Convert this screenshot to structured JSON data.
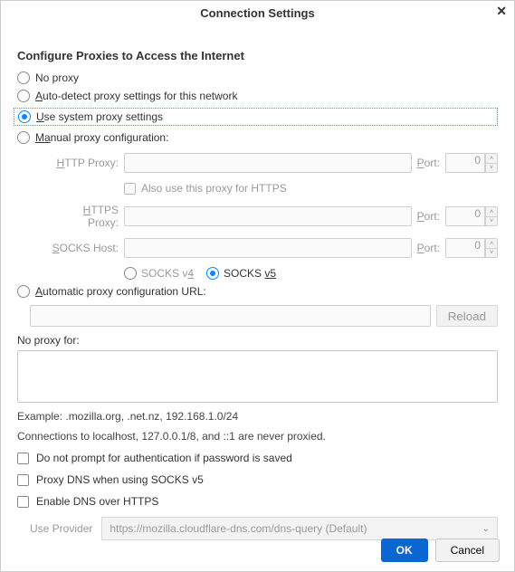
{
  "title": "Connection Settings",
  "heading": "Configure Proxies to Access the Internet",
  "radios": {
    "no_proxy": "No proxy",
    "auto_detect_pre": "A",
    "auto_detect_rest": "uto-detect proxy settings for this network",
    "use_system_pre": "U",
    "use_system_rest": "se system proxy settings",
    "manual_pre": "Ma",
    "manual_rest": "nual proxy configuration:",
    "pac_pre": "A",
    "pac_rest": "utomatic proxy configuration URL:"
  },
  "proxy": {
    "http_label_pre": "H",
    "http_label_rest": "TTP Proxy:",
    "https_label_pre": "H",
    "https_label_rest": "TTPS Proxy:",
    "socks_label_pre": "S",
    "socks_label_rest": "OCKS Host:",
    "port_label_pre": "P",
    "port_label_rest": "ort:",
    "port_value": "0",
    "also_https": "Also use this proxy for HTTPS",
    "socks4_pre": "SOCKS v",
    "socks4_rest": "4",
    "socks5_pre": "SOCKS ",
    "socks5_rest": "v5"
  },
  "reload": "Reload",
  "noproxy_label": "No proxy for:",
  "example": "Example: .mozilla.org, .net.nz, 192.168.1.0/24",
  "never_proxied": "Connections to localhost, 127.0.0.1/8, and ::1 are never proxied.",
  "checks": {
    "no_prompt": "Do not prompt for authentication if password is saved",
    "proxy_dns": "Proxy DNS when using SOCKS v5",
    "enable_doh": "Enable DNS over HTTPS"
  },
  "provider": {
    "label": "Use Provider",
    "value": "https://mozilla.cloudflare-dns.com/dns-query (Default)"
  },
  "buttons": {
    "ok": "OK",
    "cancel": "Cancel"
  }
}
